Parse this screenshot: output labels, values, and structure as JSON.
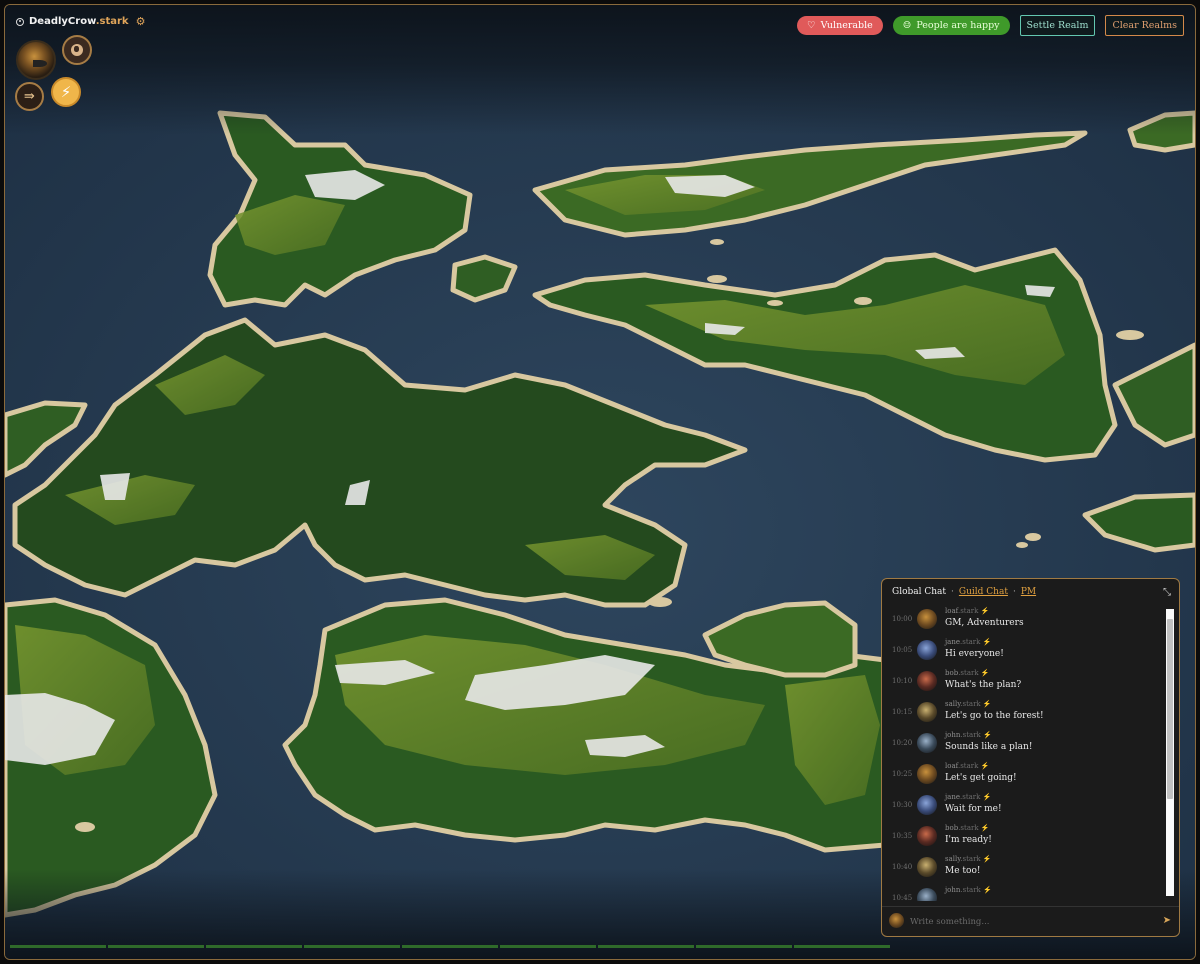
{
  "player": {
    "name": "DeadlyCrow",
    "suffix": ".stark",
    "icons": [
      "target-icon",
      "gear-icon"
    ]
  },
  "left_controls": {
    "avatar": "crow-avatar",
    "buttons": [
      "globe-icon",
      "exit-icon",
      "lightning-icon"
    ]
  },
  "status": {
    "vulnerable": "Vulnerable",
    "happiness": "People are happy"
  },
  "actions": {
    "settle": "Settle Realm",
    "clear": "Clear Realms"
  },
  "chat": {
    "tabs": {
      "global": "Global Chat",
      "guild": "Guild Chat",
      "pm": "PM"
    },
    "placeholder": "Write something...",
    "messages": [
      {
        "time": "10:00",
        "user": "loaf",
        "suffix": ".stark",
        "text": "GM, Adventurers"
      },
      {
        "time": "10:05",
        "user": "jane",
        "suffix": ".stark",
        "text": "Hi everyone!"
      },
      {
        "time": "10:10",
        "user": "bob",
        "suffix": ".stark",
        "text": "What's the plan?"
      },
      {
        "time": "10:15",
        "user": "sally",
        "suffix": ".stark",
        "text": "Let's go to the forest!"
      },
      {
        "time": "10:20",
        "user": "john",
        "suffix": ".stark",
        "text": "Sounds like a plan!"
      },
      {
        "time": "10:25",
        "user": "loaf",
        "suffix": ".stark",
        "text": "Let's get going!"
      },
      {
        "time": "10:30",
        "user": "jane",
        "suffix": ".stark",
        "text": "Wait for me!"
      },
      {
        "time": "10:35",
        "user": "bob",
        "suffix": ".stark",
        "text": "I'm ready!"
      },
      {
        "time": "10:40",
        "user": "sally",
        "suffix": ".stark",
        "text": "Me too!"
      },
      {
        "time": "10:45",
        "user": "john",
        "suffix": ".stark",
        "text": ""
      }
    ]
  },
  "colors": {
    "ocean": "#2b3f55",
    "land_dark": "#244a1e",
    "land_light": "#6c8a2a",
    "beach": "#d8c8a0",
    "accent": "#e0a55a",
    "happy": "#3f9a2a",
    "danger": "#e05a5a"
  }
}
